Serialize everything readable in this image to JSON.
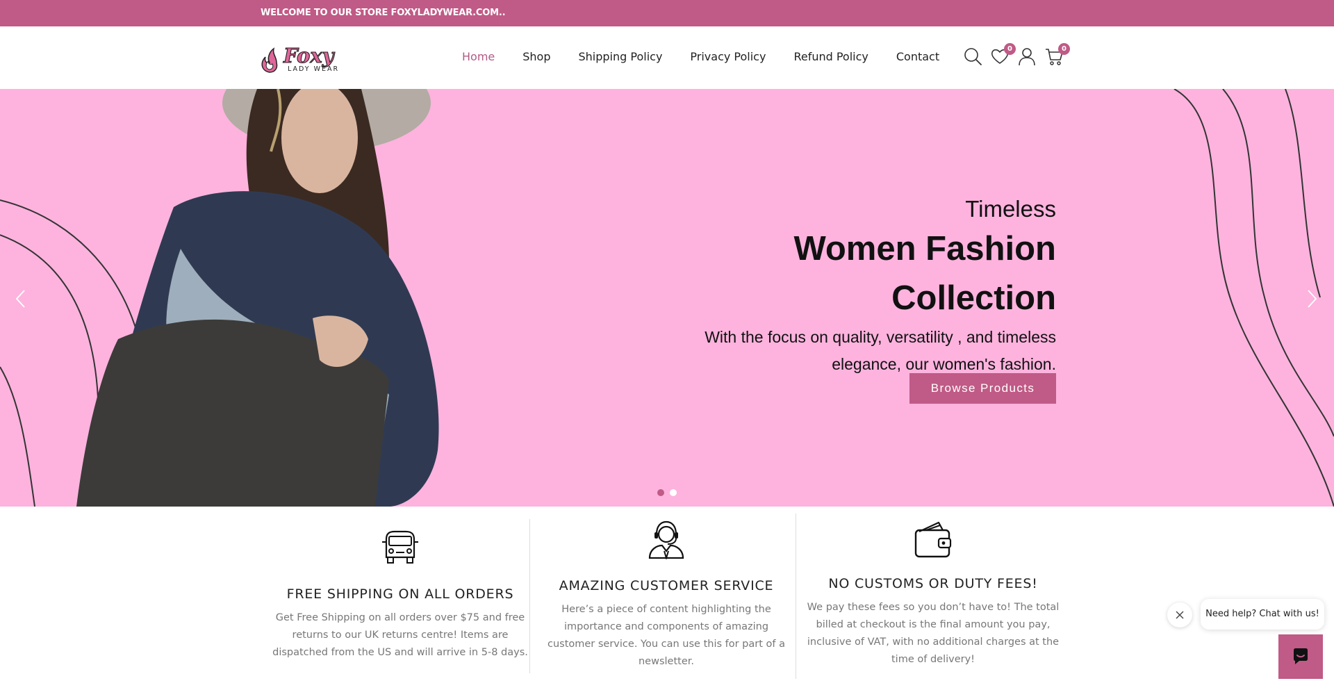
{
  "topbar": {
    "text": "WELCOME TO OUR STORE FOXYLADYWEAR.COM.."
  },
  "brand": {
    "name": "Foxy",
    "tagline": "LADY WEAR",
    "accent": "#c05a86",
    "hero_bg": "#fdb3de"
  },
  "nav": {
    "items": [
      "Home",
      "Shop",
      "Shipping Policy",
      "Privacy Policy",
      "Refund Policy",
      "Contact"
    ],
    "active": "Home"
  },
  "tools": {
    "search_icon": "search-icon",
    "wishlist_icon": "heart-icon",
    "wishlist_count": "0",
    "account_icon": "user-icon",
    "cart_icon": "cart-icon",
    "cart_count": "0"
  },
  "hero": {
    "subtitle": "Timeless",
    "title_line1": "Women Fashion",
    "title_line2": "Collection",
    "desc_line1": "With the focus on quality, versatility , and timeless",
    "desc_line2": "elegance, our women's fashion.",
    "button": "Browse Products",
    "slides": 2,
    "active_slide": 1
  },
  "features": [
    {
      "icon": "delivery-van-icon",
      "title": "FREE SHIPPING ON ALL ORDERS",
      "lines": [
        "Get Free Shipping on all orders over $75 and free",
        "returns to our UK returns centre! Items are",
        "dispatched from the US and will arrive in 5-8 days."
      ]
    },
    {
      "icon": "customer-support-icon",
      "title": "AMAZING CUSTOMER SERVICE",
      "lines": [
        "Here’s a piece of content highlighting the",
        "importance and components of amazing",
        "customer service. You can use this for part of a",
        "newsletter."
      ]
    },
    {
      "icon": "wallet-icon",
      "title": "NO CUSTOMS OR DUTY FEES!",
      "lines": [
        "We pay these fees so you don’t have to! The total",
        "billed at checkout is the final amount you pay,",
        "inclusive of VAT, with no additional charges at the",
        "time of delivery!"
      ]
    }
  ],
  "chat": {
    "prompt": "Need help? Chat with us!"
  }
}
